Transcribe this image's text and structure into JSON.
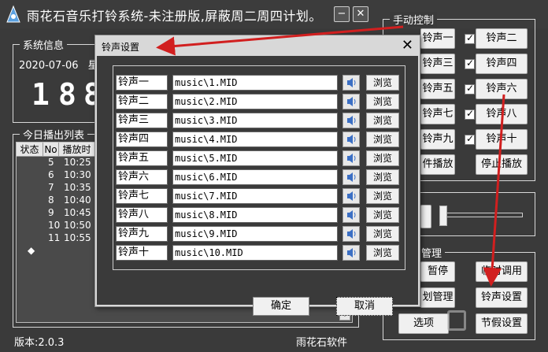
{
  "window": {
    "title": "雨花石音乐打铃系统-未注册版,屏蔽周二周四计划。",
    "minimize": "−",
    "close": "✕"
  },
  "system_info": {
    "title": "系统信息",
    "date": "2020-07-06",
    "weekday_partial": "星",
    "clock_digits": [
      "1",
      "8",
      "8"
    ]
  },
  "today_list": {
    "title": "今日播出列表",
    "columns": [
      "状态",
      "No",
      "播放时"
    ],
    "rows": [
      {
        "status": "",
        "no": "5",
        "time": "10:25"
      },
      {
        "status": "",
        "no": "6",
        "time": "10:30"
      },
      {
        "status": "",
        "no": "7",
        "time": "10:35"
      },
      {
        "status": "",
        "no": "8",
        "time": "10:40"
      },
      {
        "status": "",
        "no": "9",
        "time": "10:45"
      },
      {
        "status": "",
        "no": "10",
        "time": "10:50"
      },
      {
        "status": "",
        "no": "11",
        "time": "10:55"
      },
      {
        "status": "◆",
        "no": "",
        "time": ""
      }
    ]
  },
  "footer": {
    "version": "版本:2.0.3",
    "company": "雨花石软件"
  },
  "manual_control": {
    "title": "手动控制",
    "buttons": [
      "铃声一",
      "铃声二",
      "铃声三",
      "铃声四",
      "铃声五",
      "铃声六",
      "铃声七",
      "铃声八",
      "铃声九",
      "铃声十"
    ],
    "play_file": "件播放",
    "stop_play": "停止播放"
  },
  "management": {
    "title_partial": "管理",
    "pause": "暂停",
    "temp_call": "临时调用",
    "plan_manage": "划管理",
    "ring_settings": "铃声设置",
    "options": "选项",
    "holiday_settings": "节假设置"
  },
  "dialog": {
    "title": "铃声设置",
    "close": "✕",
    "rings": [
      {
        "name": "铃声一",
        "path": "music\\1.MID"
      },
      {
        "name": "铃声二",
        "path": "music\\2.MID"
      },
      {
        "name": "铃声三",
        "path": "music\\3.MID"
      },
      {
        "name": "铃声四",
        "path": "music\\4.MID"
      },
      {
        "name": "铃声五",
        "path": "music\\5.MID"
      },
      {
        "name": "铃声六",
        "path": "music\\6.MID"
      },
      {
        "name": "铃声七",
        "path": "music\\7.MID"
      },
      {
        "name": "铃声八",
        "path": "music\\8.MID"
      },
      {
        "name": "铃声九",
        "path": "music\\9.MID"
      },
      {
        "name": "铃声十",
        "path": "music\\10.MID"
      }
    ],
    "browse_label": "浏览",
    "ok": "确定",
    "cancel": "取消"
  },
  "colors": {
    "background": "#3a3a3a",
    "arrow": "#d11f1f",
    "button": "#f0f0f0"
  }
}
